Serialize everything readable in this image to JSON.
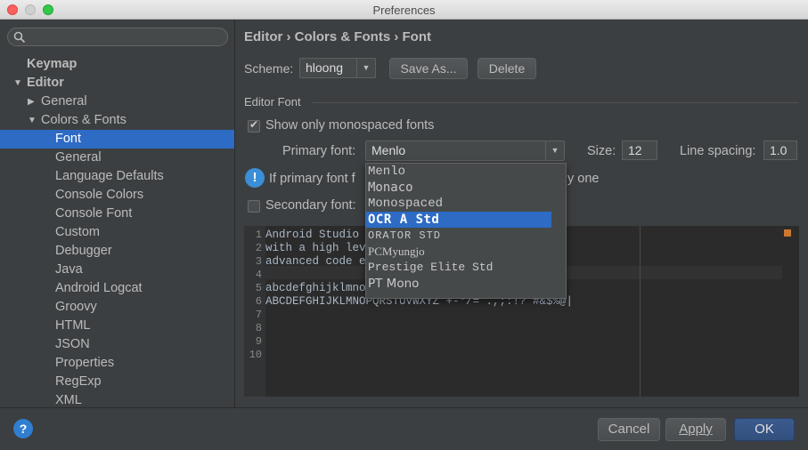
{
  "window": {
    "title": "Preferences"
  },
  "sidebar": {
    "search_placeholder": "",
    "items": [
      {
        "label": "Keymap",
        "level": 0,
        "bold": true
      },
      {
        "label": "Editor",
        "level": 0,
        "bold": true,
        "expanded": true
      },
      {
        "label": "General",
        "level": 1,
        "collapsed": true
      },
      {
        "label": "Colors & Fonts",
        "level": 1,
        "expanded": true
      },
      {
        "label": "Font",
        "level": 2,
        "selected": true
      },
      {
        "label": "General",
        "level": 2
      },
      {
        "label": "Language Defaults",
        "level": 2
      },
      {
        "label": "Console Colors",
        "level": 2
      },
      {
        "label": "Console Font",
        "level": 2
      },
      {
        "label": "Custom",
        "level": 2
      },
      {
        "label": "Debugger",
        "level": 2
      },
      {
        "label": "Java",
        "level": 2
      },
      {
        "label": "Android Logcat",
        "level": 2
      },
      {
        "label": "Groovy",
        "level": 2
      },
      {
        "label": "HTML",
        "level": 2
      },
      {
        "label": "JSON",
        "level": 2
      },
      {
        "label": "Properties",
        "level": 2
      },
      {
        "label": "RegExp",
        "level": 2
      },
      {
        "label": "XML",
        "level": 2
      }
    ]
  },
  "main": {
    "breadcrumb": "Editor › Colors & Fonts › Font",
    "scheme": {
      "label": "Scheme:",
      "value": "hloong",
      "save_as": "Save As...",
      "delete": "Delete"
    },
    "editor_font_group": "Editor Font",
    "show_mono": {
      "label": "Show only monospaced fonts",
      "checked": true
    },
    "primary_font": {
      "label": "Primary font:",
      "value": "Menlo"
    },
    "size": {
      "label": "Size:",
      "value": "12"
    },
    "line_spacing": {
      "label": "Line spacing:",
      "value": "1.0"
    },
    "info_text_left": "If primary font f",
    "info_text_right": "y one",
    "secondary_font": {
      "label": "Secondary font:",
      "checked": false
    },
    "preview": {
      "line_numbers": [
        "1",
        "2",
        "3",
        "4",
        "5",
        "6",
        "7",
        "8",
        "9",
        "10"
      ],
      "lines": [
        "Android Studio i",
        "with a high leve",
        "advanced code ed",
        "",
        "abcdefghijklmnop",
        "ABCDEFGHIJKLMNOPQRSTUVWXYZ +-*/= .,;:!? #&$%@|",
        "",
        "",
        "",
        ""
      ]
    },
    "font_dropdown": {
      "options": [
        "Menlo",
        "Monaco",
        "Monospaced",
        "OCR A Std",
        "ORATOR STD",
        "PCMyungjo",
        "Prestige Elite Std",
        "PT Mono"
      ],
      "selected": "OCR A Std"
    }
  },
  "footer": {
    "help": "?",
    "cancel": "Cancel",
    "apply": "Apply",
    "ok": "OK"
  },
  "colors": {
    "selection": "#2d6bc5",
    "background": "#3c3f41",
    "editor_bg": "#2b2b2b"
  }
}
